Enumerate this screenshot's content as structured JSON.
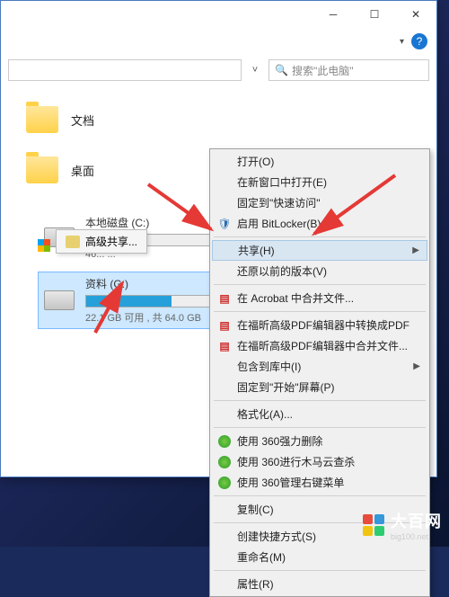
{
  "window": {
    "help_glyph": "?",
    "caret_glyph": "▾"
  },
  "search": {
    "placeholder": "搜索\"此电脑\"",
    "icon": "🔍"
  },
  "folders": [
    {
      "label": "文档"
    },
    {
      "label": "桌面"
    }
  ],
  "drives": [
    {
      "name": "本地磁盘 (C:)",
      "stats": "46... ...",
      "selected": false,
      "fill_pct": 30,
      "win_logo": true
    },
    {
      "name": "资料 (G:)",
      "stats": "22.1 GB 可用 , 共 64.0 GB",
      "selected": true,
      "fill_pct": 65,
      "win_logo": false
    }
  ],
  "submenu": {
    "label": "高级共享..."
  },
  "context_menu": [
    {
      "type": "item",
      "label": "打开(O)"
    },
    {
      "type": "item",
      "label": "在新窗口中打开(E)"
    },
    {
      "type": "item",
      "label": "固定到\"快速访问\""
    },
    {
      "type": "item",
      "label": "启用 BitLocker(B)",
      "icon": "shield"
    },
    {
      "type": "sep"
    },
    {
      "type": "item",
      "label": "共享(H)",
      "highlight": true,
      "sub": true
    },
    {
      "type": "item",
      "label": "还原以前的版本(V)"
    },
    {
      "type": "sep"
    },
    {
      "type": "item",
      "label": "在 Acrobat 中合并文件...",
      "icon": "pdf"
    },
    {
      "type": "sep"
    },
    {
      "type": "item",
      "label": "在福昕高级PDF编辑器中转换成PDF",
      "icon": "pdf2"
    },
    {
      "type": "item",
      "label": "在福昕高级PDF编辑器中合并文件...",
      "icon": "pdf2"
    },
    {
      "type": "item",
      "label": "包含到库中(I)",
      "sub": true
    },
    {
      "type": "item",
      "label": "固定到\"开始\"屏幕(P)"
    },
    {
      "type": "sep"
    },
    {
      "type": "item",
      "label": "格式化(A)..."
    },
    {
      "type": "sep"
    },
    {
      "type": "item",
      "label": "使用 360强力删除",
      "icon": "360"
    },
    {
      "type": "item",
      "label": "使用 360进行木马云查杀",
      "icon": "360"
    },
    {
      "type": "item",
      "label": "使用 360管理右键菜单",
      "icon": "360"
    },
    {
      "type": "sep"
    },
    {
      "type": "item",
      "label": "复制(C)"
    },
    {
      "type": "sep"
    },
    {
      "type": "item",
      "label": "创建快捷方式(S)"
    },
    {
      "type": "item",
      "label": "重命名(M)"
    },
    {
      "type": "sep"
    },
    {
      "type": "item",
      "label": "属性(R)"
    }
  ],
  "watermark": {
    "name": "大百网",
    "domain": "big100.net"
  }
}
